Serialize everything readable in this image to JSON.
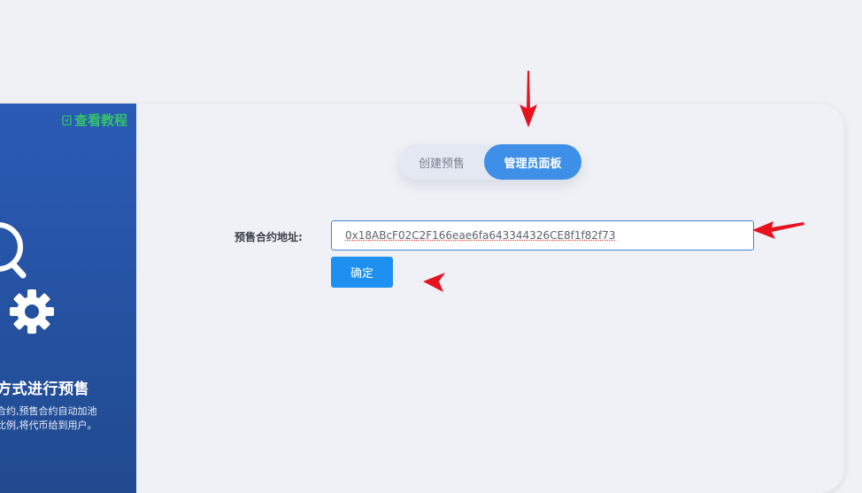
{
  "sidebar": {
    "tutorial_link": "查看教程",
    "promo_title": "方式进行预售",
    "promo_desc_line1": "合约,预售合约自动加池",
    "promo_desc_line2": "比例,将代币给到用户。"
  },
  "tabs": [
    {
      "label": "创建预售",
      "active": false
    },
    {
      "label": "管理员面板",
      "active": true
    }
  ],
  "form": {
    "label": "预售合约地址:",
    "address_value": "0x18ABcF02C2F166eae6fa643344326CE8f1f82f73",
    "confirm_label": "确定"
  },
  "colors": {
    "accent": "#3d8fe8",
    "button": "#1e90f0",
    "sidebar": "#2a5bb6",
    "link": "#34c26a",
    "annotation_arrow": "#e8121f"
  }
}
